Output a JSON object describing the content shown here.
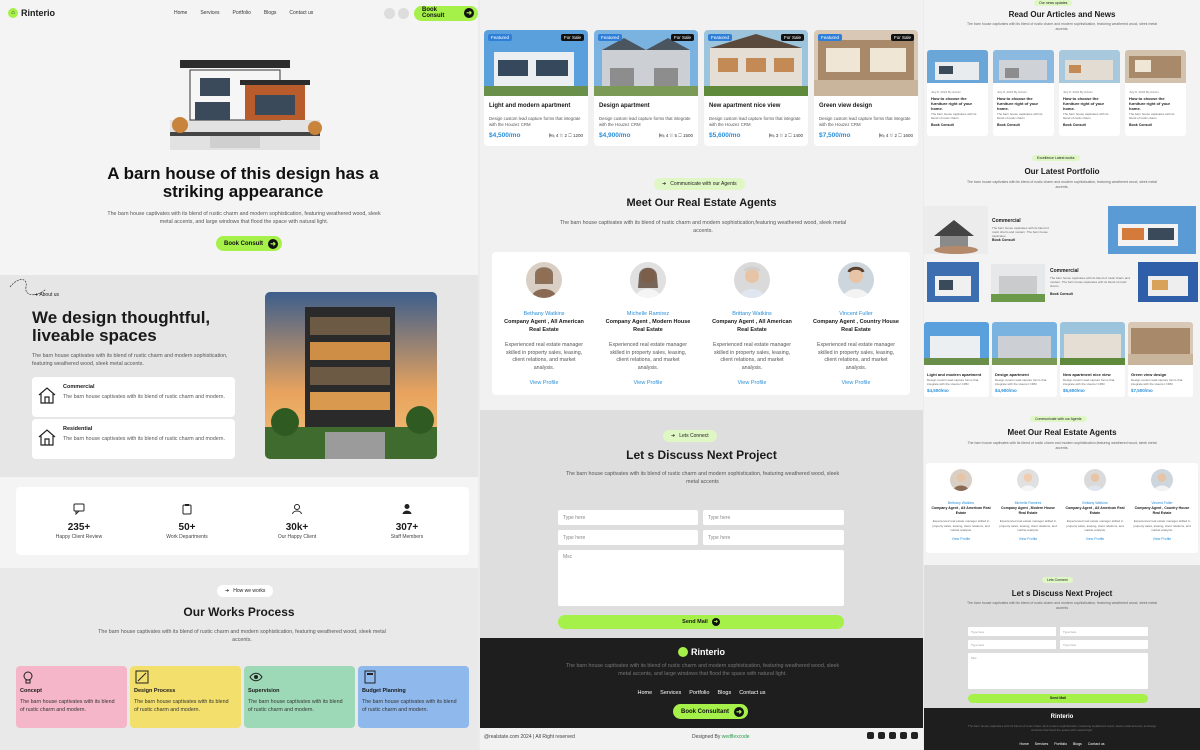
{
  "brand": "Rinterio",
  "nav": {
    "links": [
      "Home",
      "Services",
      "Portfolio",
      "Blogs",
      "Contact us"
    ],
    "cta": "Book Consult"
  },
  "hero": {
    "title": "A barn house of this design has a striking appearance",
    "desc": "The barn house captivates with its blend of rustic charm and modern sophistication, featuring weathered wood, sleek metal accents, and large windows that flood the space with natural light.",
    "cta": "Book Consult"
  },
  "about": {
    "pill": "About us",
    "title": "We design thoughtful, liveable spaces",
    "desc": "The barn house captivates with its blend of rustic charm and modern sophistication, featuring weathered wood, sleek metal accents.",
    "features": [
      {
        "title": "Commercial",
        "desc": "The barn house captivates with its blend of rustic charm and modern."
      },
      {
        "title": "Residential",
        "desc": "The barn house captivates with its blend of rustic charm and modern."
      }
    ]
  },
  "stats": [
    {
      "icon": "chat-icon",
      "num": "235+",
      "label": "Happy Client Review"
    },
    {
      "icon": "clipboard-icon",
      "num": "50+",
      "label": "Work Departments"
    },
    {
      "icon": "user-icon",
      "num": "30k+",
      "label": "Our Happy Client"
    },
    {
      "icon": "person-icon",
      "num": "307+",
      "label": "Staff Members"
    }
  ],
  "works": {
    "pill": "How we works",
    "title": "Our Works Process",
    "desc": "The barn house captivates with its blend of rustic charm and modern sophistication, featuring weathered wood, sleek metal accents.",
    "cards": [
      {
        "title": "Concept",
        "desc": "The barn house captivates with its blend of rustic charm and modern.",
        "color": "#f4b6c8",
        "icon": "lightbulb-icon"
      },
      {
        "title": "Design Process",
        "desc": "The barn house captivates with its blend of rustic charm and modern.",
        "color": "#f3df6b",
        "icon": "design-icon"
      },
      {
        "title": "Supervision",
        "desc": "The barn house captivates with its blend of rustic charm and modern.",
        "color": "#9ed9b7",
        "icon": "eye-icon"
      },
      {
        "title": "Budget Planning",
        "desc": "The barn house captivates with its blend of rustic charm and modern.",
        "color": "#8fb8ec",
        "icon": "calculator-icon"
      }
    ]
  },
  "listings": [
    {
      "title": "Light and modern apartment",
      "desc": "Design custom lead capture forms that integrate with the Houzez CRM",
      "price": "$4,500/mo",
      "beds": "4",
      "baths": "2",
      "area": "1200",
      "featured": "Featured",
      "sale": "For Sale"
    },
    {
      "title": "Design apartment",
      "desc": "Design custom lead capture forms that integrate with the Houzez CRM",
      "price": "$4,900/mo",
      "beds": "4",
      "baths": "5",
      "area": "1500",
      "featured": "Featured",
      "sale": "For Sale"
    },
    {
      "title": "New apartment nice view",
      "desc": "Design custom lead capture forms that integrate with the Houzez CRM",
      "price": "$5,600/mo",
      "beds": "3",
      "baths": "2",
      "area": "1400",
      "featured": "Featured",
      "sale": "For Sale"
    },
    {
      "title": "Green view design",
      "desc": "Design custom lead capture forms that integrate with the Houzez CRM",
      "price": "$7,500/mo",
      "beds": "4",
      "baths": "2",
      "area": "1600",
      "featured": "Featured",
      "sale": "For Sale"
    }
  ],
  "agents_section": {
    "pill": "Communicate with our Agents",
    "title": "Meet Our Real Estate Agents",
    "desc": "The barn house captivates with its blend of rustic charm and modern sophistication,featuring weathered wood, sleek metal accents.",
    "agents": [
      {
        "name": "Bethany Watkins",
        "role": "Company Agent , All American Real Estate",
        "desc": "Experienced real estate manager skilled in property sales, leasing, client relations, and market analysis.",
        "link": "View Profile"
      },
      {
        "name": "Michelle Ramirez",
        "role": "Company Agent , Modern House Real Estate",
        "desc": "Experienced real estate manager skilled in property sales, leasing, client relations, and market analysis.",
        "link": "View Profile"
      },
      {
        "name": "Brittany Watkins",
        "role": "Company Agent , All American Real Estate",
        "desc": "Experienced real estate manager skilled in property sales, leasing, client relations, and market analysis.",
        "link": "View Profile"
      },
      {
        "name": "Vincent Fuller",
        "role": "Company Agent , Country House Real Estate",
        "desc": "Experienced real estate manager skilled in property sales, leasing, client relations, and market analysis.",
        "link": "View Profile"
      }
    ]
  },
  "contact": {
    "pill": "Lets Connect",
    "title": "Let s Discuss Next Project",
    "desc": "The barn house captivates with its blend of rustic charm and modern sophistication, featuring weathered wood, sleek metal accents",
    "placeholder": "Type here",
    "message_placeholder": "Msc",
    "send": "Send Mail"
  },
  "footer": {
    "brand": "Rinterio",
    "desc": "The barn house captivates with its blend of rustic charm and modern sophistication, featuring weathered wood, sleek metal accents, and large windows that flood the space with natural light.",
    "links": [
      "Home",
      "Services",
      "Portfolio",
      "Blogs",
      "Contact us"
    ],
    "cta": "Book Consultant",
    "copyright": "@realstate.com 2024 | All Right reserved",
    "designed_by": "Designed By",
    "designer": "wedflexcode"
  },
  "preview": {
    "news_pill": "Our news updates",
    "news_title": "Read Our Articles and News",
    "news_desc": "The barn house captivates with its blend of rustic charm and modern sophistication, featuring weathered wood, sleek metal accents.",
    "news": [
      {
        "meta": "July 8, 2024   By Admin",
        "title": "How to choose the furniture right of your home.",
        "desc": "The barn house captivates with its blend of rustic charm",
        "link": "Book Consult"
      },
      {
        "meta": "July 8, 2024   By Admin",
        "title": "How to choose the furniture right of your home.",
        "desc": "The barn house captivates with its blend of rustic charm",
        "link": "Book Consult"
      },
      {
        "meta": "July 8, 2024   By Admin",
        "title": "How to choose the furniture right of your home.",
        "desc": "The barn house captivates with its blend of rustic charm",
        "link": "Book Consult"
      },
      {
        "meta": "July 8, 2024   By Admin",
        "title": "How to choose the furniture right of your home.",
        "desc": "The barn house captivates with its blend of rustic charm",
        "link": "Book Consult"
      }
    ],
    "portfolio_pill": "Excellence Latest works",
    "portfolio_title": "Our Latest Portfolio",
    "portfolio_desc": "The barn house captivates with its blend of rustic charm and modern sophistication, featuring weathered wood, sleek metal accents.",
    "portfolio_items": [
      {
        "title": "Commercial",
        "desc": "The barn house captivates with its blend of rustic charm and modern. The barn house captivates.",
        "link": "Book Consult"
      },
      {
        "title": "Commercial",
        "desc": "The barn house captivates with its blend of rustic charm and modern. The barn house captivates with its blend of rustic charm.",
        "link": "Book Consult"
      }
    ],
    "agents_pill": "Communicate with our Agents",
    "agents_title": "Meet Our Real Estate Agents",
    "agents_desc": "The barn house captivates with its blend of rustic charm and modern sophistication,featuring weathered wood, sleek metal accents.",
    "contact_pill": "Lets Connect",
    "contact_title": "Let s Discuss Next Project",
    "contact_desc": "The barn house captivates with its blend of rustic charm and modern sophistication, featuring weathered wood, sleek metal accents",
    "footer_desc": "The barn house captivates with its blend of rustic charm and modern sophistication, featuring weathered wood, sleek metal accents, and large windows that flood the space with natural light."
  },
  "colors": {
    "accent": "#a6f04a",
    "price": "#2a8fd8",
    "footer": "#1e1e1e"
  }
}
